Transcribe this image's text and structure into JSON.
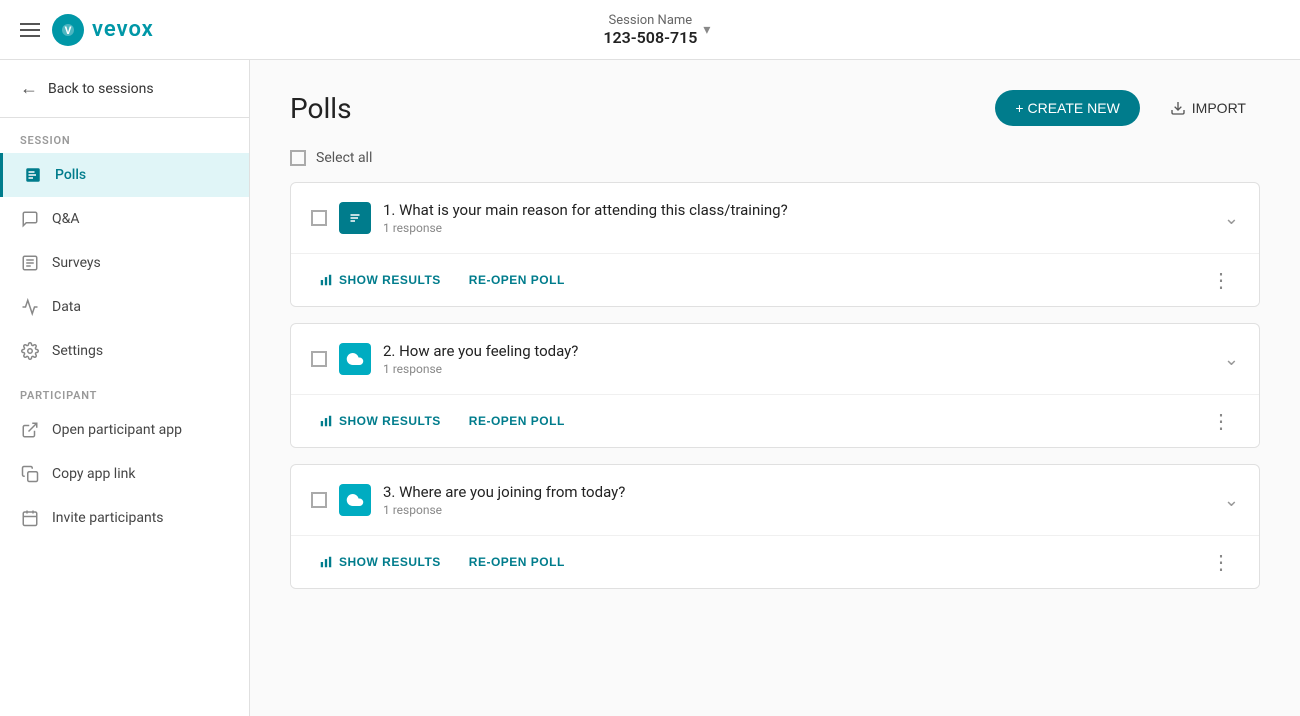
{
  "header": {
    "menu_icon": "hamburger-icon",
    "logo_letter": "V",
    "logo_text": "vevox",
    "session_label": "Session Name",
    "session_code": "123-508-715",
    "dropdown_label": "▾"
  },
  "sidebar": {
    "back_label": "Back to sessions",
    "session_section": "SESSION",
    "session_items": [
      {
        "id": "polls",
        "label": "Polls",
        "active": true
      },
      {
        "id": "qa",
        "label": "Q&A",
        "active": false
      },
      {
        "id": "surveys",
        "label": "Surveys",
        "active": false
      },
      {
        "id": "data",
        "label": "Data",
        "active": false
      },
      {
        "id": "settings",
        "label": "Settings",
        "active": false
      }
    ],
    "participant_section": "PARTICIPANT",
    "participant_items": [
      {
        "id": "open-app",
        "label": "Open participant app"
      },
      {
        "id": "copy-link",
        "label": "Copy app link"
      },
      {
        "id": "invite",
        "label": "Invite participants"
      }
    ]
  },
  "main": {
    "page_title": "Polls",
    "create_button": "+ CREATE NEW",
    "import_button": "IMPORT",
    "select_all": "Select all",
    "polls": [
      {
        "number": 1,
        "title": "1. What is your main reason for attending this class/training?",
        "responses": "1 response",
        "icon_type": "list",
        "show_results": "SHOW RESULTS",
        "reopen": "RE-OPEN POLL"
      },
      {
        "number": 2,
        "title": "2. How are you feeling today?",
        "responses": "1 response",
        "icon_type": "cloud",
        "show_results": "SHOW RESULTS",
        "reopen": "RE-OPEN POLL"
      },
      {
        "number": 3,
        "title": "3. Where are you joining from today?",
        "responses": "1 response",
        "icon_type": "cloud",
        "show_results": "SHOW RESULTS",
        "reopen": "RE-OPEN POLL"
      }
    ]
  }
}
